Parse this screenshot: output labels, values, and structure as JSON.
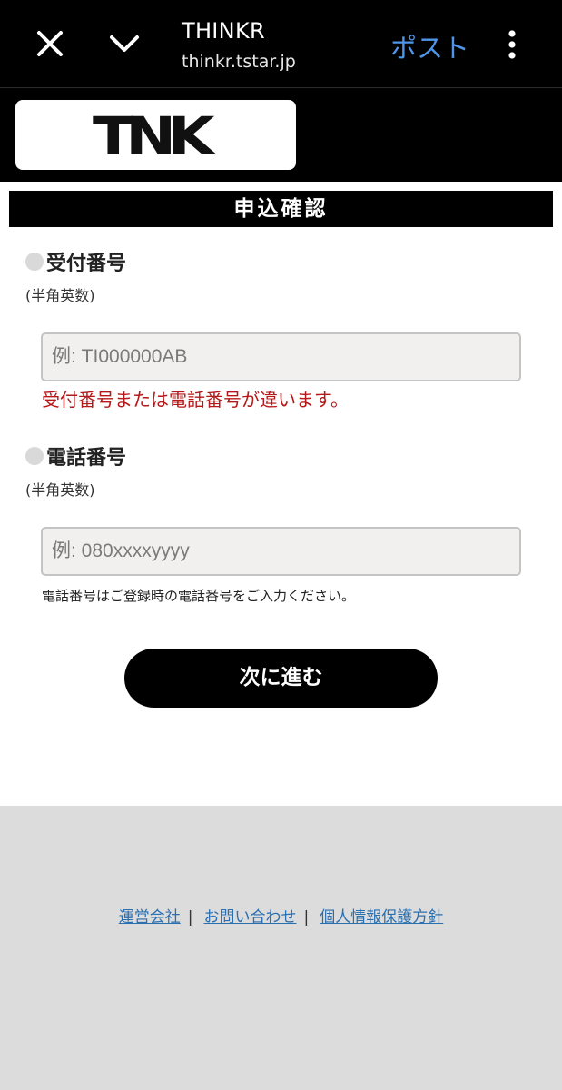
{
  "browser": {
    "title": "THINKR",
    "url": "thinkr.tstar.jp",
    "post_label": "ポスト",
    "icons": {
      "close": "close-icon",
      "collapse": "chevron-down-icon",
      "more": "more-vert-icon"
    },
    "post_color": "#4f95e8"
  },
  "header": {
    "logo_text": "TNK"
  },
  "section": {
    "title": "申込確認"
  },
  "form": {
    "receipt": {
      "label": "受付番号",
      "hint": "(半角英数)",
      "placeholder": "例: TI000000AB",
      "value": ""
    },
    "error": "受付番号または電話番号が違います。",
    "phone": {
      "label": "電話番号",
      "hint": "(半角英数)",
      "placeholder": "例: 080xxxxyyyy",
      "value": "",
      "note": "電話番号はご登録時の電話番号をご入力ください。"
    },
    "next_label": "次に進む"
  },
  "footer": {
    "links": [
      "運営会社",
      "お問い合わせ",
      "個人情報保護方針"
    ],
    "separator": "|"
  },
  "colors": {
    "error": "#b51818",
    "link": "#2a6fb0",
    "footer_bg": "#dcdcdc"
  }
}
